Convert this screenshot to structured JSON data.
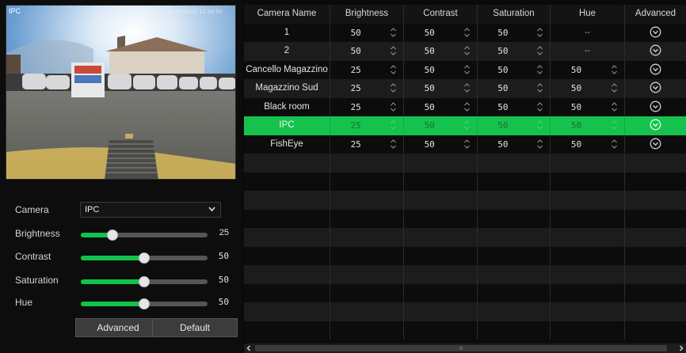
{
  "preview": {
    "channel_label": "IPC",
    "timestamp": "25/05/2020 12:34:56"
  },
  "controls": {
    "camera": {
      "label": "Camera",
      "value": "IPC"
    },
    "brightness": {
      "label": "Brightness",
      "value": "25",
      "level": 0.25
    },
    "contrast": {
      "label": "Contrast",
      "value": "50",
      "level": 0.5
    },
    "saturation": {
      "label": "Saturation",
      "value": "50",
      "level": 0.5
    },
    "hue": {
      "label": "Hue",
      "value": "50",
      "level": 0.5
    },
    "advanced_button": "Advanced",
    "default_button": "Default"
  },
  "table": {
    "headers": [
      "Camera Name",
      "Brightness",
      "Contrast",
      "Saturation",
      "Hue",
      "Advanced"
    ],
    "rows": [
      {
        "name": "1",
        "brightness": "50",
        "contrast": "50",
        "saturation": "50",
        "hue": "--"
      },
      {
        "name": "2",
        "brightness": "50",
        "contrast": "50",
        "saturation": "50",
        "hue": "--"
      },
      {
        "name": "Cancello Magazzino",
        "brightness": "25",
        "contrast": "50",
        "saturation": "50",
        "hue": "50"
      },
      {
        "name": "Magazzino Sud",
        "brightness": "25",
        "contrast": "50",
        "saturation": "50",
        "hue": "50"
      },
      {
        "name": "Black room",
        "brightness": "25",
        "contrast": "50",
        "saturation": "50",
        "hue": "50"
      },
      {
        "name": "IPC",
        "brightness": "25",
        "contrast": "50",
        "saturation": "50",
        "hue": "50"
      },
      {
        "name": "FishEye",
        "brightness": "25",
        "contrast": "50",
        "saturation": "50",
        "hue": "50"
      }
    ],
    "selected_row": 5,
    "empty_rows": 10
  },
  "colors": {
    "accent": "#16c24e",
    "slider_track": "#555555",
    "row_alt": "#1c1c1c"
  }
}
